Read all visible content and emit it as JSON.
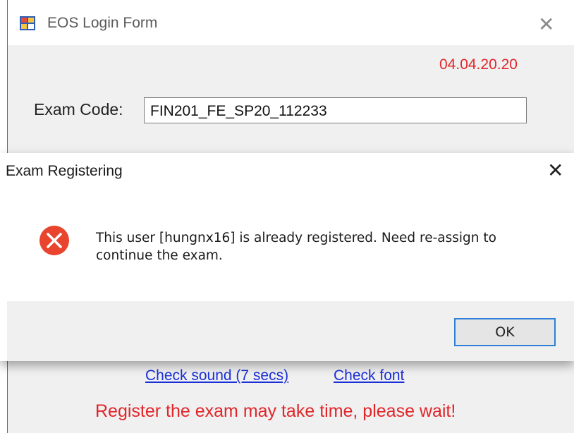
{
  "window": {
    "title": "EOS Login Form",
    "close_glyph": "✕",
    "date": "04.04.20.20",
    "exam_code_label": "Exam Code:",
    "exam_code_value": "FIN201_FE_SP20_112233",
    "check_sound_link": "Check sound (7 secs)",
    "check_font_link": "Check font",
    "wait_message": "Register the exam may take time, please wait!"
  },
  "dialog": {
    "title": "Exam Registering",
    "close_glyph": "✕",
    "message_line1": "This user [hungnx16] is already registered. Need re-assign to",
    "message_line2": "continue the exam.",
    "ok_label": "OK",
    "icon": "error-icon"
  },
  "colors": {
    "accent_red": "#e0262a",
    "link_blue": "#1a2fd8",
    "button_focus": "#2f7fd6"
  }
}
